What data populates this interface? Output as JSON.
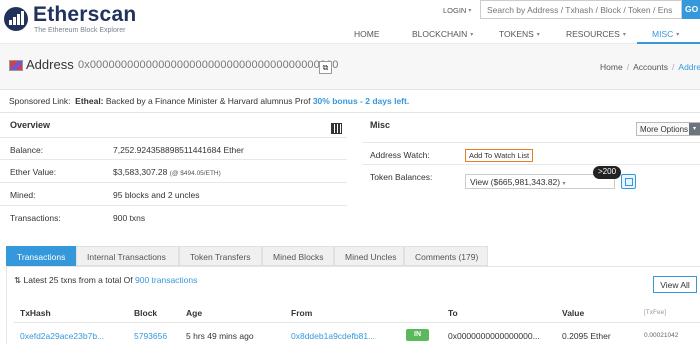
{
  "header": {
    "logo_name": "Etherscan",
    "logo_tagline": "The Ethereum Block Explorer",
    "login": "LOGIN",
    "search_placeholder": "Search by Address / Txhash / Block / Token / Ens",
    "search_button": "GO",
    "nav": [
      {
        "label": "HOME"
      },
      {
        "label": "BLOCKCHAIN"
      },
      {
        "label": "TOKENS"
      },
      {
        "label": "RESOURCES"
      },
      {
        "label": "MISC"
      }
    ],
    "active_nav": "MISC",
    "accent_color": "#3498db"
  },
  "title": {
    "label": "Address",
    "address": "0x0000000000000000000000000000000000000000",
    "breadcrumb": [
      "Home",
      "Accounts",
      "Address"
    ]
  },
  "sponsored": {
    "label": "Sponsored Link:",
    "name": "Etheal:",
    "text": "Backed by a Finance Minister & Harvard alumnus Prof",
    "highlight": "30% bonus - 2 days left."
  },
  "overview": {
    "heading": "Overview",
    "rows": [
      {
        "label": "Balance:",
        "value": "7,252.924358898511441684 Ether"
      },
      {
        "label": "Ether Value:",
        "value": "$3,583,307.28",
        "sub": "(@ $494.05/ETH)"
      },
      {
        "label": "Mined:",
        "value": "95 blocks and 2 uncles"
      },
      {
        "label": "Transactions:",
        "value": "900 txns"
      }
    ]
  },
  "misc": {
    "heading": "Misc",
    "more_options": "More Options",
    "address_watch_label": "Address Watch:",
    "add_watch_button": "Add To Watch List",
    "token_balances_label": "Token Balances:",
    "token_balances_value": "View ($665,981,343.82)",
    "token_count_badge": ">200"
  },
  "tabs": [
    {
      "label": "Transactions"
    },
    {
      "label": "Internal Transactions"
    },
    {
      "label": "Token Transfers"
    },
    {
      "label": "Mined Blocks"
    },
    {
      "label": "Mined Uncles"
    },
    {
      "label": "Comments (179)"
    }
  ],
  "active_tab": "Transactions",
  "transactions": {
    "summary_prefix": "Latest 25 txns from a total Of",
    "summary_link": "900 transactions",
    "view_all": "View All",
    "columns": [
      "TxHash",
      "Block",
      "Age",
      "From",
      "",
      "To",
      "Value",
      "[TxFee]"
    ],
    "rows": [
      {
        "txhash": "0xefd2a29ace23b7b...",
        "block": "5793656",
        "age": "5 hrs 49 mins ago",
        "from": "0x8ddeb1a9cdefb81...",
        "direction": "IN",
        "to": "0x0000000000000000...",
        "value": "0.2095 Ether",
        "fee": "0.00021042"
      }
    ]
  }
}
